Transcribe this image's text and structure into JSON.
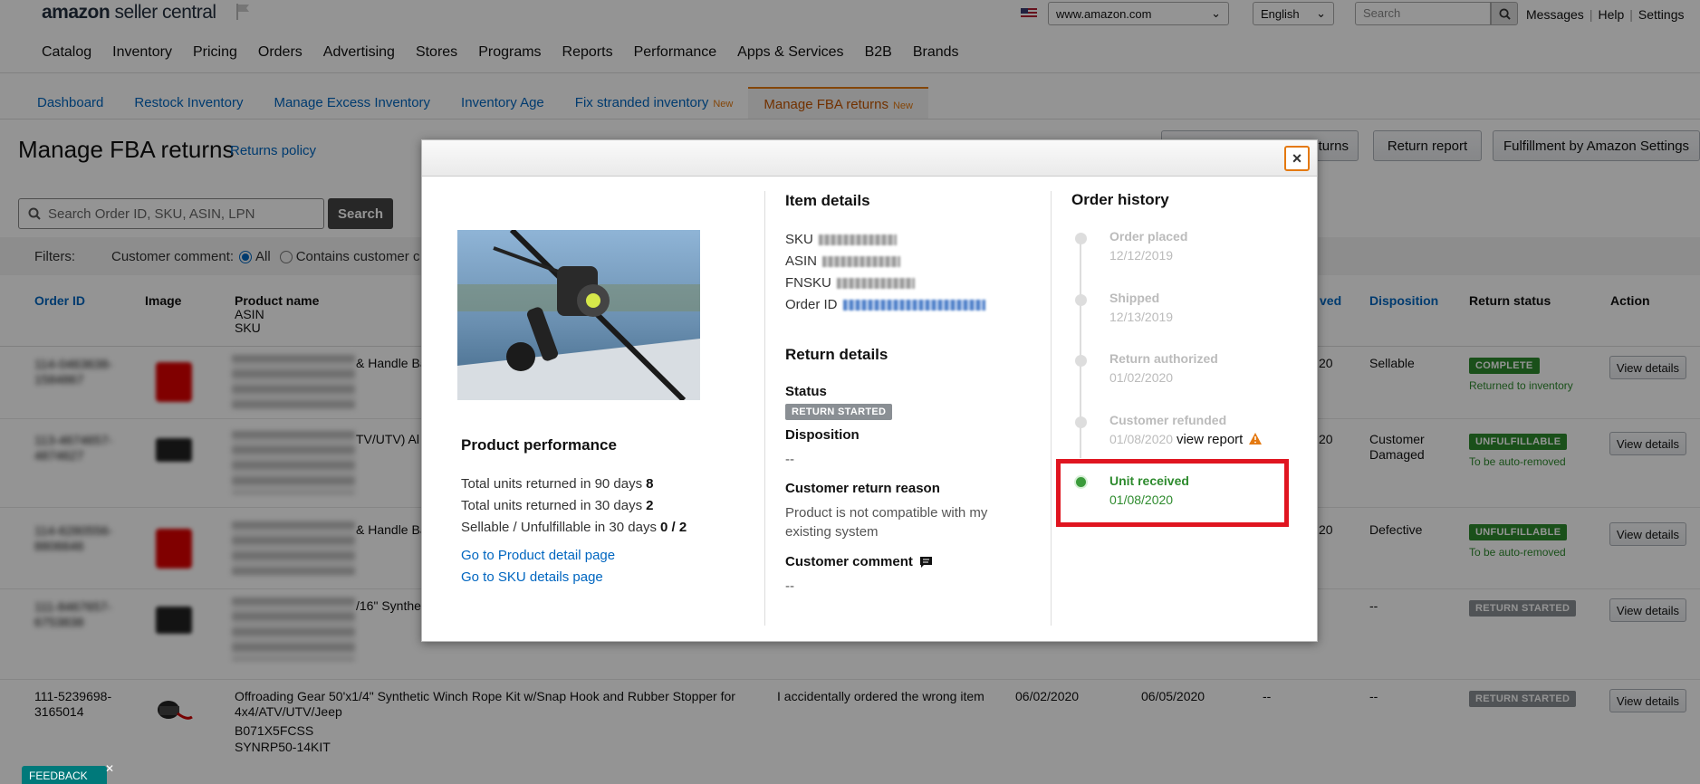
{
  "header": {
    "logo_bold": "amazon",
    "logo_light": " seller central",
    "marketplace": "www.amazon.com",
    "language": "English",
    "search_placeholder": "Search",
    "links": [
      "Messages",
      "Help",
      "Settings"
    ]
  },
  "nav": [
    "Catalog",
    "Inventory",
    "Pricing",
    "Orders",
    "Advertising",
    "Stores",
    "Programs",
    "Reports",
    "Performance",
    "Apps & Services",
    "B2B",
    "Brands"
  ],
  "tabs": [
    {
      "label": "Dashboard",
      "new": ""
    },
    {
      "label": "Restock Inventory",
      "new": ""
    },
    {
      "label": "Manage Excess Inventory",
      "new": ""
    },
    {
      "label": "Inventory Age",
      "new": ""
    },
    {
      "label": "Fix stranded inventory",
      "new": "New"
    },
    {
      "label": "Manage FBA returns",
      "new": "New"
    }
  ],
  "page": {
    "title": "Manage FBA returns",
    "returns_policy": "Returns policy",
    "btn_returns_partial": "eturns",
    "btn_return_report": "Return report",
    "btn_fba_settings": "Fulfillment by Amazon Settings",
    "search_placeholder": "Search Order ID, SKU, ASIN, LPN",
    "search_btn": "Search",
    "filters_label": "Filters:",
    "customer_comment_label": "Customer comment:",
    "filter_all": "All",
    "filter_contains": "Contains customer c"
  },
  "table": {
    "headers": {
      "order_id": "Order ID",
      "image": "Image",
      "product_name": "Product name",
      "asin": "ASIN",
      "sku": "SKU",
      "received_partial": "ved",
      "disposition": "Disposition",
      "return_status": "Return status",
      "action": "Action"
    },
    "rows": [
      {
        "order_id": "114-0463638-1584867",
        "product": "Offroading Gear Winch & Handle Bar",
        "product_visible": "& Handle Ba",
        "date_partial": "20",
        "disposition": "Sellable",
        "status": "COMPLETE",
        "note": "Returned to inventory",
        "action": "View details"
      },
      {
        "order_id": "113-4674657-4874627",
        "product": "Offroading Gear ATV/UTV Al",
        "product_visible": "TV/UTV) Al",
        "date_partial": "20",
        "disposition": "Customer Damaged",
        "status": "UNFULFILLABLE",
        "note": "To be auto-removed",
        "action": "View details"
      },
      {
        "order_id": "114-6280556-8806646",
        "product": "Offroading Gear & Handle Ba",
        "product_visible": "& Handle Ba",
        "date_partial": "20",
        "disposition": "Defective",
        "status": "UNFULFILLABLE",
        "note": "To be auto-removed",
        "action": "View details"
      },
      {
        "order_id": "111-8467657-6753838",
        "product": "Offroading Gear /16\" Synthe",
        "product_visible": "/16\" Synthe",
        "date_partial": "",
        "disposition": "--",
        "status": "RETURN STARTED",
        "note": "",
        "action": "View details"
      },
      {
        "order_id": "111-5239698-3165014",
        "product": "Offroading Gear 50'x1/4\" Synthetic Winch Rope Kit w/Snap Hook and Rubber Stopper for 4x4/ATV/UTV/Jeep",
        "asin": "B071X5FCSS",
        "sku": "SYNRP50-14KIT",
        "reason": "I accidentally ordered the wrong item",
        "date1": "06/02/2020",
        "date2": "06/05/2020",
        "received": "--",
        "disposition": "--",
        "status": "RETURN STARTED",
        "note": "",
        "action": "View details"
      }
    ]
  },
  "feedback": "FEEDBACK",
  "modal": {
    "close": "×",
    "product_performance": {
      "title": "Product performance",
      "lines": [
        {
          "label": "Total units returned in 90 days",
          "value": "8"
        },
        {
          "label": "Total units returned in 30 days",
          "value": "2"
        },
        {
          "label": "Sellable / Unfulfillable in 30 days",
          "value": "0 / 2"
        }
      ],
      "link_product": "Go to Product detail page",
      "link_sku": "Go to SKU details page"
    },
    "item_details": {
      "title": "Item details",
      "sku_label": "SKU",
      "asin_label": "ASIN",
      "fnsku_label": "FNSKU",
      "order_id_label": "Order ID"
    },
    "return_details": {
      "title": "Return details",
      "status_label": "Status",
      "status_value": "RETURN STARTED",
      "disposition_label": "Disposition",
      "disposition_value": "--",
      "reason_label": "Customer return reason",
      "reason_value": "Product is not compatible with my existing system",
      "comment_label": "Customer comment",
      "comment_value": "--"
    },
    "order_history": {
      "title": "Order history",
      "events": [
        {
          "title": "Order placed",
          "date": "12/12/2019"
        },
        {
          "title": "Shipped",
          "date": "12/13/2019"
        },
        {
          "title": "Return authorized",
          "date": "01/02/2020"
        },
        {
          "title": "Customer refunded",
          "date": "01/08/2020",
          "link": "view report"
        },
        {
          "title": "Unit received",
          "date": "01/08/2020"
        }
      ]
    }
  }
}
